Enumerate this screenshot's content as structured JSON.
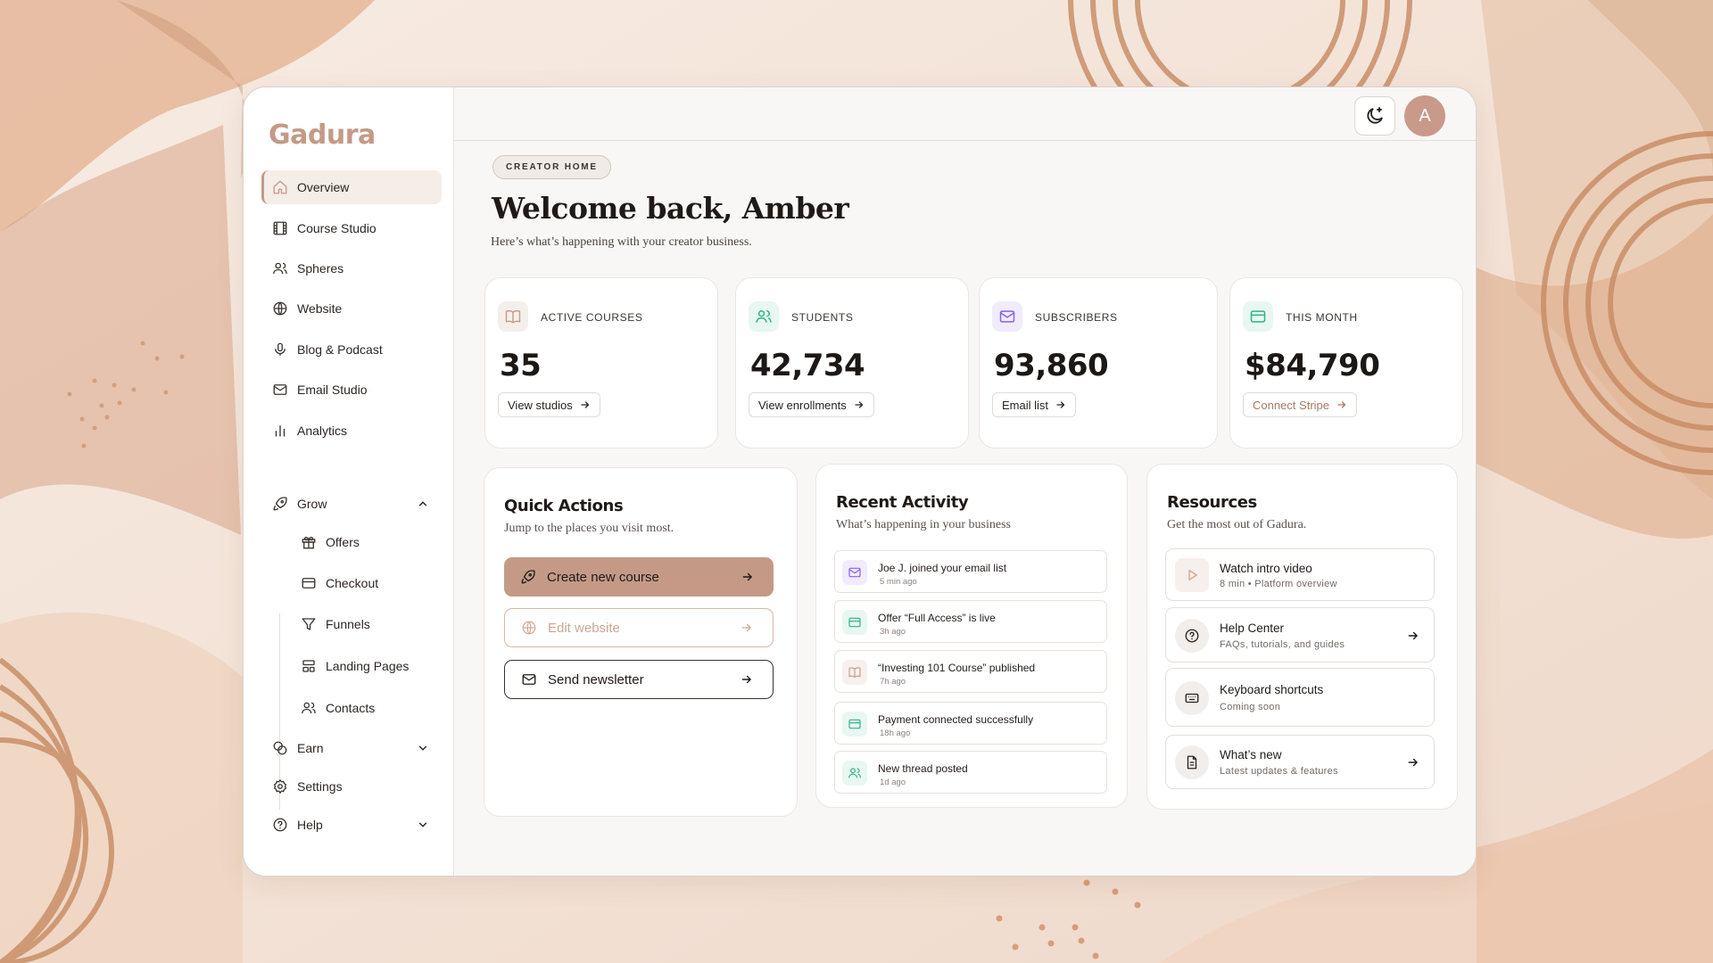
{
  "brand": "Gadura",
  "colors": {
    "accent": "#c49a86",
    "primary_button": "#c49a86",
    "teal": "#2fb28a",
    "purple": "#8b5cf6"
  },
  "sidebar": {
    "items": [
      {
        "label": "Overview",
        "icon": "home-icon"
      },
      {
        "label": "Course Studio",
        "icon": "film-icon"
      },
      {
        "label": "Spheres",
        "icon": "users-icon"
      },
      {
        "label": "Website",
        "icon": "globe-icon"
      },
      {
        "label": "Blog & Podcast",
        "icon": "microphone-icon"
      },
      {
        "label": "Email Studio",
        "icon": "mail-icon"
      },
      {
        "label": "Analytics",
        "icon": "bar-chart-icon"
      }
    ],
    "grow": {
      "label": "Grow",
      "children": [
        {
          "label": "Offers",
          "icon": "gift-icon"
        },
        {
          "label": "Checkout",
          "icon": "credit-card-icon"
        },
        {
          "label": "Funnels",
          "icon": "funnel-icon"
        },
        {
          "label": "Landing Pages",
          "icon": "layout-icon"
        },
        {
          "label": "Contacts",
          "icon": "contacts-icon"
        }
      ]
    },
    "earn": {
      "label": "Earn"
    },
    "settings": {
      "label": "Settings"
    },
    "help": {
      "label": "Help"
    }
  },
  "header": {
    "avatar_initial": "A",
    "theme_toggle_icon": "moon-icon"
  },
  "hero": {
    "pill": "CREATOR HOME",
    "title": "Welcome back, Amber",
    "subtitle": "Here’s what’s happening with your creator business."
  },
  "stats": [
    {
      "label": "ACTIVE COURSES",
      "value": "35",
      "link": "View studios",
      "icon": "book-icon"
    },
    {
      "label": "STUDENTS",
      "value": "42,734",
      "link": "View enrollments",
      "icon": "users-icon"
    },
    {
      "label": "SUBSCRIBERS",
      "value": "93,860",
      "link": "Email list",
      "icon": "mail-icon"
    },
    {
      "label": "THIS MONTH",
      "value": "$84,790",
      "link": "Connect Stripe",
      "icon": "credit-card-icon"
    }
  ],
  "quick_actions": {
    "title": "Quick Actions",
    "subtitle": "Jump to the places you visit most.",
    "buttons": [
      {
        "label": "Create new course",
        "icon": "rocket-icon"
      },
      {
        "label": "Edit website",
        "icon": "globe-icon"
      },
      {
        "label": "Send newsletter",
        "icon": "mail-icon"
      }
    ]
  },
  "recent_activity": {
    "title": "Recent Activity",
    "subtitle": "What’s happening in your business",
    "items": [
      {
        "title": "Joe J. joined your email list",
        "time": "5 min ago",
        "icon": "mail-icon"
      },
      {
        "title": "Offer “Full Access” is live",
        "time": "3h ago",
        "icon": "credit-card-icon"
      },
      {
        "title": "“Investing 101 Course” published",
        "time": "7h ago",
        "icon": "book-icon"
      },
      {
        "title": "Payment connected successfully",
        "time": "18h ago",
        "icon": "credit-card-icon"
      },
      {
        "title": "New thread posted",
        "time": "1d ago",
        "icon": "users-icon"
      }
    ]
  },
  "resources": {
    "title": "Resources",
    "subtitle": "Get the most out of Gadura.",
    "items": [
      {
        "title": "Watch intro video",
        "sub": "8 min • Platform overview",
        "icon": "play-icon"
      },
      {
        "title": "Help Center",
        "sub": "FAQs, tutorials, and guides",
        "icon": "help-circle-icon"
      },
      {
        "title": "Keyboard shortcuts",
        "sub": "Coming soon",
        "icon": "keyboard-icon"
      },
      {
        "title": "What’s new",
        "sub": "Latest updates & features",
        "icon": "document-icon"
      }
    ]
  }
}
